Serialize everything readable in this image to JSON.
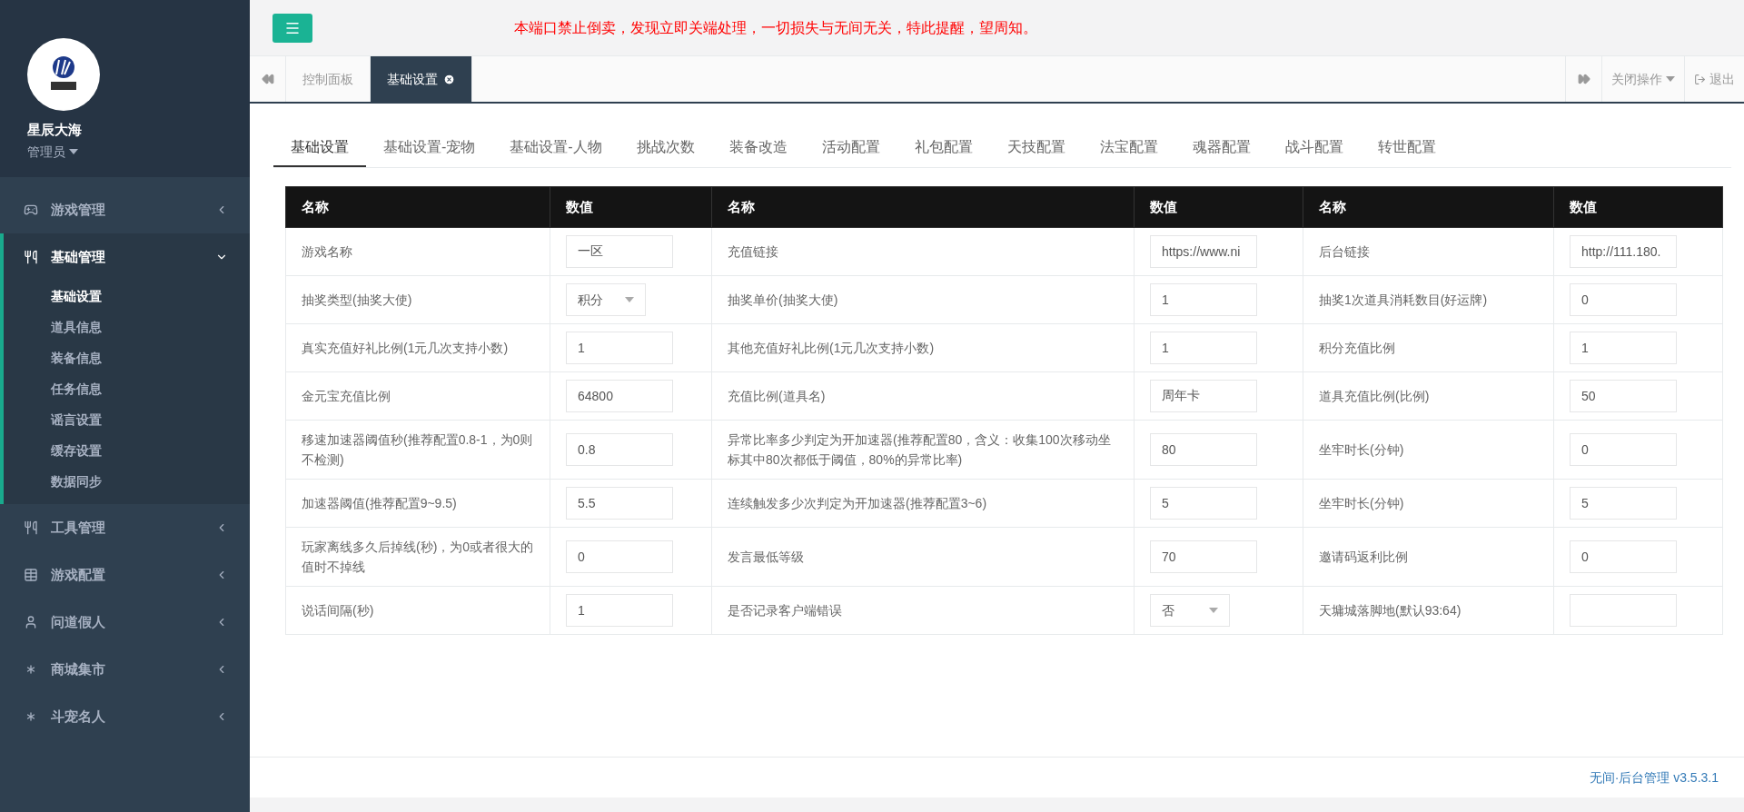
{
  "profile": {
    "name": "星辰大海",
    "role": "管理员"
  },
  "sidebar": {
    "items": [
      {
        "label": "游戏管理",
        "expanded": false
      },
      {
        "label": "基础管理",
        "expanded": true,
        "children": [
          {
            "label": "基础设置",
            "selected": true
          },
          {
            "label": "道具信息",
            "selected": false
          },
          {
            "label": "装备信息",
            "selected": false
          },
          {
            "label": "任务信息",
            "selected": false
          },
          {
            "label": "谣言设置",
            "selected": false
          },
          {
            "label": "缓存设置",
            "selected": false
          },
          {
            "label": "数据同步",
            "selected": false
          }
        ]
      },
      {
        "label": "工具管理",
        "expanded": false
      },
      {
        "label": "游戏配置",
        "expanded": false
      },
      {
        "label": "问道假人",
        "expanded": false
      },
      {
        "label": "商城集市",
        "expanded": false
      },
      {
        "label": "斗宠名人",
        "expanded": false
      }
    ]
  },
  "notice": "本端口禁止倒卖，发现立即关端处理，一切损失与无间无关，特此提醒，望周知。",
  "page_tabs": [
    {
      "label": "控制面板",
      "selected": false,
      "closable": false
    },
    {
      "label": "基础设置",
      "selected": true,
      "closable": true
    }
  ],
  "tab_actions": {
    "close_menu": "关闭操作",
    "logout": "退出"
  },
  "settings_tabs": [
    {
      "label": "基础设置",
      "selected": true
    },
    {
      "label": "基础设置-宠物",
      "selected": false
    },
    {
      "label": "基础设置-人物",
      "selected": false
    },
    {
      "label": "挑战次数",
      "selected": false
    },
    {
      "label": "装备改造",
      "selected": false
    },
    {
      "label": "活动配置",
      "selected": false
    },
    {
      "label": "礼包配置",
      "selected": false
    },
    {
      "label": "天技配置",
      "selected": false
    },
    {
      "label": "法宝配置",
      "selected": false
    },
    {
      "label": "魂器配置",
      "selected": false
    },
    {
      "label": "战斗配置",
      "selected": false
    },
    {
      "label": "转世配置",
      "selected": false
    }
  ],
  "table": {
    "columns": [
      "名称",
      "数值",
      "名称",
      "数值",
      "名称",
      "数值"
    ],
    "rows": [
      [
        {
          "kind": "label",
          "text": "游戏名称"
        },
        {
          "kind": "input",
          "value": "一区"
        },
        {
          "kind": "label",
          "text": "充值链接"
        },
        {
          "kind": "input",
          "value": "https://www.ni"
        },
        {
          "kind": "label",
          "text": "后台链接"
        },
        {
          "kind": "input",
          "value": "http://111.180."
        }
      ],
      [
        {
          "kind": "label",
          "text": "抽奖类型(抽奖大使)"
        },
        {
          "kind": "select",
          "value": "积分"
        },
        {
          "kind": "label",
          "text": "抽奖单价(抽奖大使)"
        },
        {
          "kind": "input",
          "value": "1"
        },
        {
          "kind": "label",
          "text": "抽奖1次道具消耗数目(好运牌)"
        },
        {
          "kind": "input",
          "value": "0"
        }
      ],
      [
        {
          "kind": "label",
          "text": "真实充值好礼比例(1元几次支持小数)"
        },
        {
          "kind": "input",
          "value": "1"
        },
        {
          "kind": "label",
          "text": "其他充值好礼比例(1元几次支持小数)"
        },
        {
          "kind": "input",
          "value": "1"
        },
        {
          "kind": "label",
          "text": "积分充值比例"
        },
        {
          "kind": "input",
          "value": "1"
        }
      ],
      [
        {
          "kind": "label",
          "text": "金元宝充值比例"
        },
        {
          "kind": "input",
          "value": "64800"
        },
        {
          "kind": "label",
          "text": "充值比例(道具名)"
        },
        {
          "kind": "input",
          "value": "周年卡"
        },
        {
          "kind": "label",
          "text": "道具充值比例(比例)"
        },
        {
          "kind": "input",
          "value": "50"
        }
      ],
      [
        {
          "kind": "label",
          "text": "移速加速器阈值秒(推荐配置0.8-1，为0则不检测)"
        },
        {
          "kind": "input",
          "value": "0.8"
        },
        {
          "kind": "label",
          "text": "异常比率多少判定为开加速器(推荐配置80，含义：收集100次移动坐标其中80次都低于阈值，80%的异常比率)"
        },
        {
          "kind": "input",
          "value": "80"
        },
        {
          "kind": "label",
          "text": "坐牢时长(分钟)"
        },
        {
          "kind": "input",
          "value": "0"
        }
      ],
      [
        {
          "kind": "label",
          "text": "加速器阈值(推荐配置9~9.5)"
        },
        {
          "kind": "input",
          "value": "5.5"
        },
        {
          "kind": "label",
          "text": "连续触发多少次判定为开加速器(推荐配置3~6)"
        },
        {
          "kind": "input",
          "value": "5"
        },
        {
          "kind": "label",
          "text": "坐牢时长(分钟)"
        },
        {
          "kind": "input",
          "value": "5"
        }
      ],
      [
        {
          "kind": "label",
          "text": "玩家离线多久后掉线(秒)，为0或者很大的值时不掉线"
        },
        {
          "kind": "input",
          "value": "0"
        },
        {
          "kind": "label",
          "text": "发言最低等级"
        },
        {
          "kind": "input",
          "value": "70"
        },
        {
          "kind": "label",
          "text": "邀请码返利比例"
        },
        {
          "kind": "input",
          "value": "0"
        }
      ],
      [
        {
          "kind": "label",
          "text": "说话间隔(秒)"
        },
        {
          "kind": "input",
          "value": "1"
        },
        {
          "kind": "label",
          "text": "是否记录客户端错误"
        },
        {
          "kind": "select",
          "value": "否"
        },
        {
          "kind": "label",
          "text": "天墉城落脚地(默认93:64)"
        },
        {
          "kind": "input"
        }
      ]
    ]
  },
  "footer": "无间·后台管理 v3.5.3.1"
}
